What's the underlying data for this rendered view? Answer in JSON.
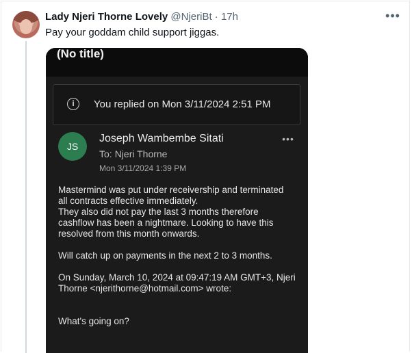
{
  "tweet": {
    "author_name": "Lady Njeri Thorne Lovely",
    "handle": "@NjeriBt",
    "separator": "·",
    "time": "17h",
    "more_icon": "more-horizontal-icon",
    "text": "Pay your goddam child support jiggas."
  },
  "screenshot": {
    "title": "(No title)",
    "notice": {
      "icon": "info-icon",
      "text": "You replied on Mon 3/11/2024 2:51 PM"
    },
    "message": {
      "initials": "JS",
      "sender": "Joseph Wambembe Sitati",
      "to_label": "To:",
      "to_name": "Njeri Thorne",
      "date": "Mon 3/11/2024 1:39 PM",
      "more_icon": "more-horizontal-icon",
      "body": [
        "Mastermind was put under receivership and terminated",
        "all contracts effective immediately.",
        "They also did not pay the last 3 months therefore",
        "cashflow has been a nightmare. Looking to have this",
        "resolved from this month onwards.",
        "",
        "Will catch up on payments in the next 2 to 3 months.",
        "",
        "On Sunday, March 10, 2024 at 09:47:19 AM GMT+3, Njeri",
        "Thorne <njerithorne@hotmail.com> wrote:",
        "",
        "",
        "What's going on?"
      ]
    }
  }
}
